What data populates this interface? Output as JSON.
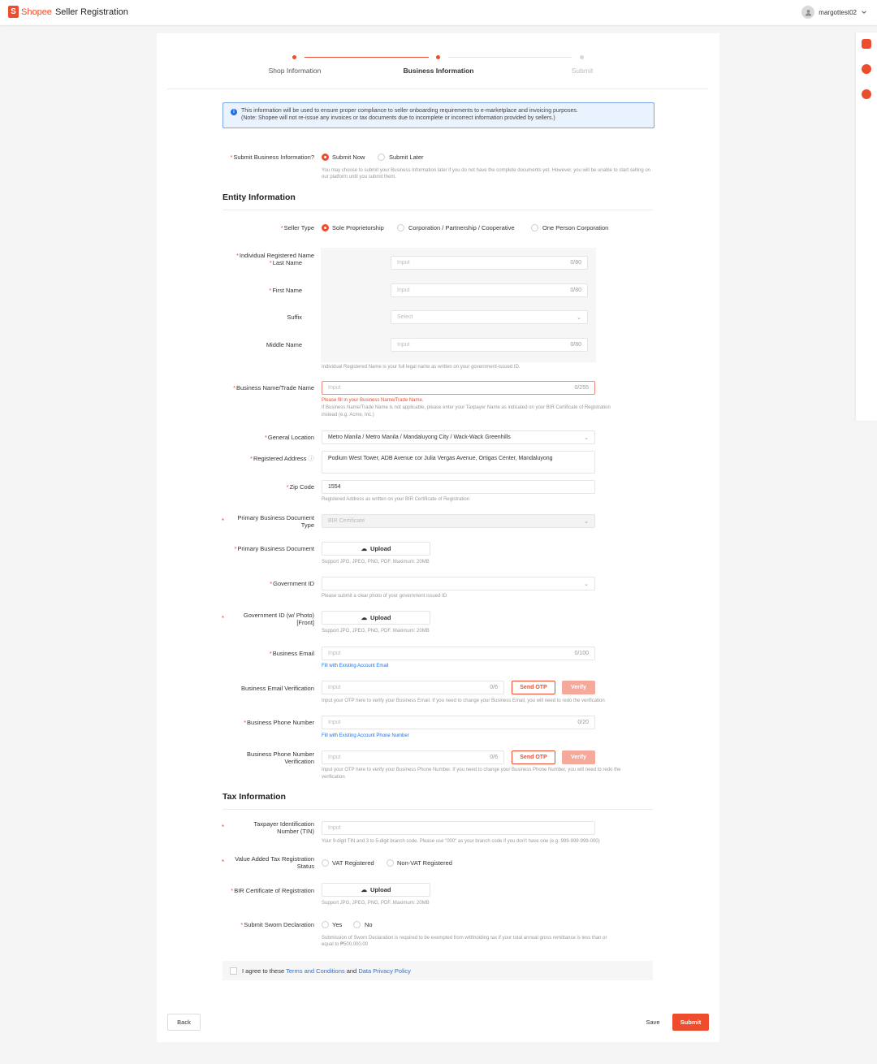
{
  "header": {
    "logo_letter": "S",
    "logo_brand": "Shopee",
    "app_title": "Seller Registration",
    "username": "margottest02"
  },
  "colors": {
    "accent": "#ee4d2d",
    "link": "#2673dd",
    "info": "#1f6fe5"
  },
  "steps": [
    {
      "label": "Shop Information",
      "state": "done"
    },
    {
      "label": "Business Information",
      "state": "active"
    },
    {
      "label": "Submit",
      "state": "pending"
    }
  ],
  "notice": {
    "line1": "This information will be used to ensure proper compliance to seller onboarding requirements to e-marketplace and invoicing purposes.",
    "line2": "(Note: Shopee will not re-issue any invoices or tax documents due to incomplete or incorrect information provided by sellers.)"
  },
  "submit_info": {
    "label": "Submit Business Information?",
    "options": [
      "Submit Now",
      "Submit Later"
    ],
    "selected": "Submit Now",
    "hint": "You may choose to submit your Business Information later if you do not have the complete documents yet. However, you will be unable to start selling on our platform until you submit them."
  },
  "entity": {
    "title": "Entity Information",
    "seller_type": {
      "label": "Seller Type",
      "options": [
        "Sole Proprietorship",
        "Corporation / Partnership / Cooperative",
        "One Person Corporation"
      ],
      "selected": "Sole Proprietorship"
    },
    "registered_name": {
      "label": "Individual Registered Name",
      "last_name": {
        "label": "Last Name",
        "placeholder": "Input",
        "count": "0/80"
      },
      "first_name": {
        "label": "First Name",
        "placeholder": "Input",
        "count": "0/80"
      },
      "suffix": {
        "label": "Suffix",
        "placeholder": "Select"
      },
      "middle_name": {
        "label": "Middle Name",
        "placeholder": "Input",
        "count": "0/80"
      },
      "hint": "Individual Registered Name is your full legal name as written on your government-issued ID."
    },
    "business_name": {
      "label": "Business Name/Trade Name",
      "placeholder": "Input",
      "count": "0/255",
      "error": "Please fill in your Business Name/Trade Name.",
      "hint1": "If Business Name/Trade Name is not applicable, please enter your Taxpayer Name as indicated on your BIR Certificate of Registration",
      "hint2": "instead (e.g. Acme, Inc.)"
    },
    "location": {
      "label": "General Location",
      "value": "Metro Manila / Metro Manila / Mandaluyong City / Wack-Wack Greenhills"
    },
    "address": {
      "label": "Registered Address",
      "value": "Podium West Tower, ADB Avenue cor Julia Vergas Avenue, Ortigas Center, Mandaluyong"
    },
    "zip": {
      "label": "Zip Code",
      "value": "1554",
      "hint": "Registered Address as written on your BIR Certificate of Registration"
    },
    "primary_doc_type": {
      "label1": "Primary Business Document",
      "label2": "Type",
      "value": "BIR Certificate"
    },
    "primary_doc": {
      "label": "Primary Business Document",
      "button": "Upload",
      "hint": "Support JPG, JPEG, PNG, PDF. Maximum: 20MB"
    },
    "gov_id": {
      "label": "Government ID",
      "hint": "Please submit a clear photo of your government issued ID"
    },
    "gov_id_photo": {
      "label1": "Government ID (w/ Photo)",
      "label2": "[Front]",
      "button": "Upload",
      "hint": "Support JPG, JPEG, PNG, PDF. Maximum: 20MB"
    },
    "email": {
      "label": "Business Email",
      "placeholder": "Input",
      "count": "0/100",
      "link": "Fill with Existing Account Email"
    },
    "email_verify": {
      "label": "Business Email Verification",
      "placeholder": "Input",
      "count": "0/6",
      "send": "Send OTP",
      "verify": "Verify",
      "hint": "Input your OTP here to verify your Business Email. If you need to change your Business Email, you will need to redo the verification"
    },
    "phone": {
      "label": "Business Phone Number",
      "placeholder": "Input",
      "count": "0/20",
      "link": "Fill with Existing Account Phone Number"
    },
    "phone_verify": {
      "label1": "Business Phone Number",
      "label2": "Verification",
      "placeholder": "Input",
      "count": "0/6",
      "send": "Send OTP",
      "verify": "Verify",
      "hint1": "Input your OTP here to verify your Business Phone Number. If you need to change your Business Phone Number, you will need to redo the",
      "hint2": "verification"
    }
  },
  "tax": {
    "title": "Tax Information",
    "tin": {
      "label1": "Taxpayer Identification",
      "label2": "Number (TIN)",
      "placeholder": "Input",
      "hint": "Your 9-digit TIN and 3 to 5-digit branch code. Please use \"000\" as your branch code if you don't have one (e.g. 999-999-999-000)"
    },
    "vat": {
      "label1": "Value Added Tax Registration",
      "label2": "Status",
      "options": [
        "VAT Registered",
        "Non-VAT Registered"
      ]
    },
    "bir": {
      "label": "BIR Certificate of Registration",
      "button": "Upload",
      "hint": "Support JPG, JPEG, PNG, PDF. Maximum: 20MB"
    },
    "sworn": {
      "label": "Submit Sworn Declaration",
      "options": [
        "Yes",
        "No"
      ],
      "hint1": "Submission of Sworn Declaration is required to be exempted from withholding tax if your total annual gross remittance is less than or",
      "hint2": "equal to ₱500,000.00"
    }
  },
  "agreement": {
    "prefix": "I agree to these ",
    "terms": "Terms and Conditions",
    "and": " and ",
    "privacy": "Data Privacy Policy"
  },
  "footer": {
    "back": "Back",
    "save": "Save",
    "submit": "Submit"
  }
}
